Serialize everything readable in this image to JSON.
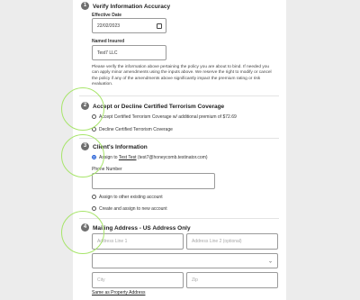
{
  "section1": {
    "number": "1",
    "title": "Verify Information Accuracy",
    "effective_date_label": "Effective Date",
    "effective_date_value": "22/02/2023",
    "named_insured_label": "Named Insured",
    "named_insured_value": "Test7 LLC",
    "disclaimer": "Please verify the information above pertaining the policy you are about to bind. If needed you can apply minor amendments using the inputs above. We reserve the right to modify or cancel the policy if any of the amendments above significantly impact the premium rating or risk evaluation."
  },
  "section2": {
    "number": "2",
    "title": "Accept or Decline Certified Terrorism Coverage",
    "option_accept": "Accept Certified Terrorism Coverage w/ additional premium of $72.69",
    "option_decline": "Decline Certified Terrorism Coverage"
  },
  "section3": {
    "number": "3",
    "title": "Client's Information",
    "assign_prefix": "Assign to",
    "assign_name": "Test Test",
    "assign_email": "(test7@honeycomb.testinator.com)",
    "phone_label": "Phone Number",
    "option_existing": "Assign to other existing account",
    "option_new": "Create and assign to new account"
  },
  "section4": {
    "number": "4",
    "title": "Mailing Address - US Address Only",
    "address1_placeholder": "Address Line 1",
    "address2_placeholder": "Address Line 2 (optional)",
    "city_placeholder": "City",
    "zip_placeholder": "Zip",
    "same_as_property": "Same as Property Address"
  },
  "colors": {
    "highlight_circle": "#a7e56a",
    "radio_selected": "#1e5bd6"
  },
  "icons": [
    "calendar-icon",
    "chevron-down-icon"
  ]
}
